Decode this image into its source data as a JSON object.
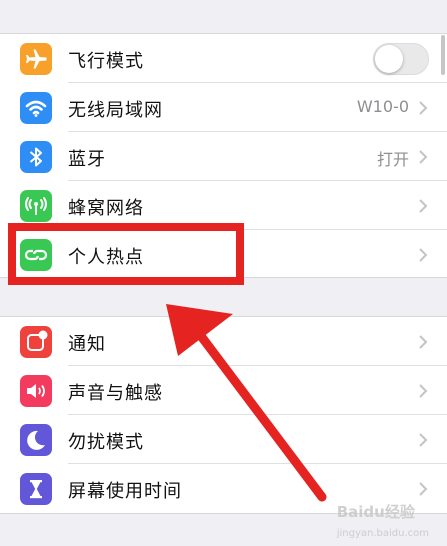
{
  "settings": {
    "group1": [
      {
        "label": "飞行模式",
        "icon": "airplane-icon",
        "color": "#f7a12b",
        "control": "toggle",
        "toggle_on": false
      },
      {
        "label": "无线局域网",
        "icon": "wifi-icon",
        "color": "#2f8ef5",
        "value": "W10-0"
      },
      {
        "label": "蓝牙",
        "icon": "bluetooth-icon",
        "color": "#2f8ef5",
        "value": "打开"
      },
      {
        "label": "蜂窝网络",
        "icon": "cellular-icon",
        "color": "#39c853",
        "value": ""
      },
      {
        "label": "个人热点",
        "icon": "hotspot-icon",
        "color": "#39c853",
        "value": ""
      }
    ],
    "group2": [
      {
        "label": "通知",
        "icon": "notifications-icon",
        "color": "#f0423d",
        "value": ""
      },
      {
        "label": "声音与触感",
        "icon": "sounds-icon",
        "color": "#f23b5f",
        "value": ""
      },
      {
        "label": "勿扰模式",
        "icon": "moon-icon",
        "color": "#6157d8",
        "value": ""
      },
      {
        "label": "屏幕使用时间",
        "icon": "hourglass-icon",
        "color": "#6157d8",
        "value": ""
      }
    ]
  },
  "annotation": {
    "highlight_color": "#e52421",
    "highlighted_item": "个人热点"
  },
  "watermark": {
    "text": "Bai",
    "paw": "du",
    "suffix": "经验",
    "sub": "jingyan.baidu.com"
  }
}
